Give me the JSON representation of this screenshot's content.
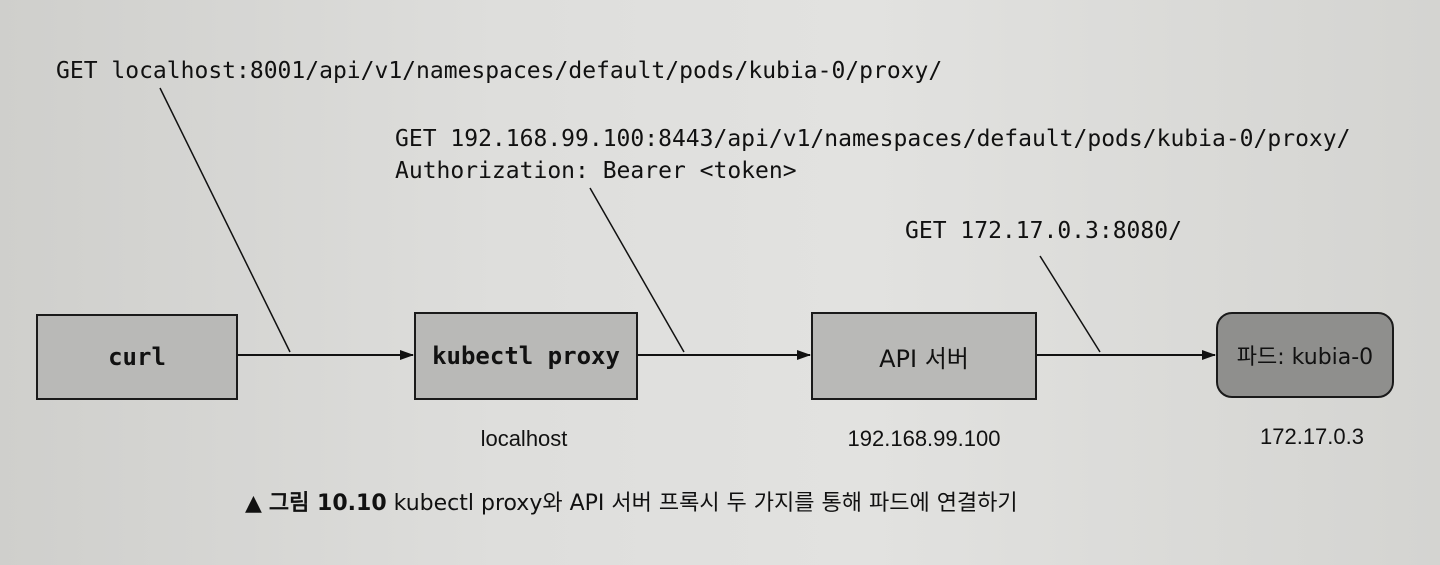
{
  "requests": {
    "curl_request": "GET localhost:8001/api/v1/namespaces/default/pods/kubia-0/proxy/",
    "proxy_request_line1": "GET 192.168.99.100:8443/api/v1/namespaces/default/pods/kubia-0/proxy/",
    "proxy_request_line2": "Authorization: Bearer <token>",
    "api_request": "GET 172.17.0.3:8080/"
  },
  "nodes": {
    "curl": "curl",
    "kubectl_proxy": "kubectl proxy",
    "api_server": "API 서버",
    "pod": "파드: kubia-0"
  },
  "addresses": {
    "kubectl_proxy": "localhost",
    "api_server": "192.168.99.100",
    "pod": "172.17.0.3"
  },
  "caption": {
    "marker": "▲",
    "figure": "그림 10.10",
    "text": "kubectl proxy와 API 서버 프록시 두 가지를 통해 파드에 연결하기"
  }
}
